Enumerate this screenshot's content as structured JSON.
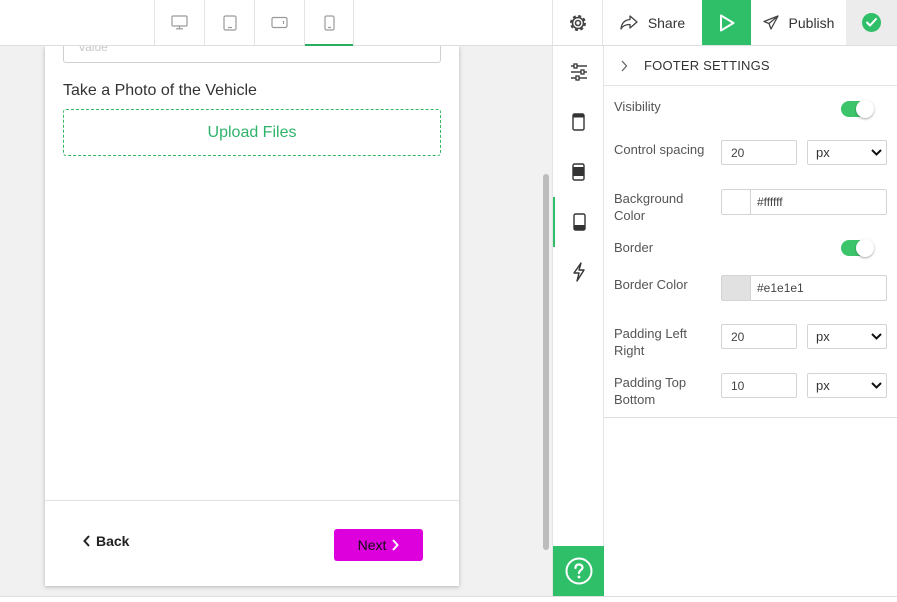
{
  "topbar": {
    "devices": [
      {
        "name": "desktop",
        "active": false
      },
      {
        "name": "tablet",
        "active": false
      },
      {
        "name": "tablet-landscape",
        "active": false
      },
      {
        "name": "mobile",
        "active": true
      }
    ],
    "share_label": "Share",
    "publish_label": "Publish"
  },
  "form": {
    "prev_input_placeholder": "Value",
    "photo_label": "Take a Photo of the Vehicle",
    "upload_label": "Upload Files",
    "back_label": "Back",
    "next_label": "Next",
    "next_color": "#dd00dd"
  },
  "panel": {
    "title": "FOOTER SETTINGS",
    "visibility_label": "Visibility",
    "visibility_on": true,
    "control_spacing_label": "Control spacing",
    "control_spacing_value": "20",
    "control_spacing_unit": "px",
    "background_color_label": "Background Color",
    "background_color_value": "#ffffff",
    "border_label": "Border",
    "border_on": true,
    "border_color_label": "Border Color",
    "border_color_value": "#e1e1e1",
    "padding_lr_label": "Padding Left Right",
    "padding_lr_value": "20",
    "padding_lr_unit": "px",
    "padding_tb_label": "Padding Top Bottom",
    "padding_tb_value": "10",
    "padding_tb_unit": "px"
  },
  "colors": {
    "accent": "#2fbf68",
    "next_button": "#dd00dd"
  }
}
